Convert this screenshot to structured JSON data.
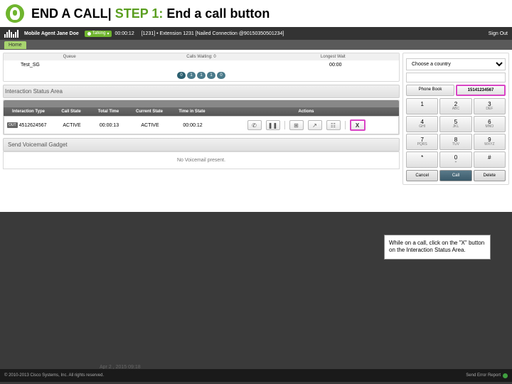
{
  "slide": {
    "title_pre": "END A CALL| ",
    "title_step": "STEP 1: ",
    "title_post": "End a call button"
  },
  "topbar": {
    "agent": "Mobile Agent Jane Doe",
    "state": "Talking",
    "timer": "00:00:12",
    "ext": "[1231] • Extension 1231 [Nailed Connection @90150350501234]",
    "signout": "Sign Out"
  },
  "tabs": {
    "home": "Home"
  },
  "queue": {
    "h1": "Queue",
    "h2": "Calls Waiting: 0",
    "h3": "Longest Wait",
    "name": "Test_SG",
    "waiting": "",
    "longest": "00:00",
    "pages": [
      "0",
      "1",
      "1",
      "1",
      "0"
    ]
  },
  "interaction": {
    "label": "Interaction Status Area",
    "cols": {
      "type": "Interaction Type",
      "state": "Call State",
      "total": "Total Time",
      "cur": "Current State",
      "tis": "Time in State",
      "act": "Actions"
    },
    "row": {
      "dir": "OUT",
      "num": "4512624567",
      "state": "ACTIVE",
      "total": "00:00:13",
      "cur": "ACTIVE",
      "tis": "00:00:12",
      "end": "X"
    }
  },
  "voicemail": {
    "label": "Send Voicemail Gadget",
    "empty": "No Voicemail present."
  },
  "dialer": {
    "country": "Choose a country",
    "phonebook": "Phone Book",
    "this_num": "15141234567",
    "keys": [
      {
        "n": "1",
        "t": ""
      },
      {
        "n": "2",
        "t": "ABC"
      },
      {
        "n": "3",
        "t": "DEF"
      },
      {
        "n": "4",
        "t": "GHI"
      },
      {
        "n": "5",
        "t": "JKL"
      },
      {
        "n": "6",
        "t": "MNO"
      },
      {
        "n": "7",
        "t": "PQRS"
      },
      {
        "n": "8",
        "t": "TUV"
      },
      {
        "n": "9",
        "t": "WXYZ"
      },
      {
        "n": "*",
        "t": ""
      },
      {
        "n": "0",
        "t": "+"
      },
      {
        "n": "#",
        "t": ""
      }
    ],
    "cancel": "Cancel",
    "call": "Call",
    "delete": "Delete"
  },
  "callout": "While on a call, click on the \"X\" button on the Interaction Status Area.",
  "footer": {
    "copy": "© 2010-2013 Cisco Systems, Inc. All rights reserved.",
    "ghost": "Apr 2 , 2015 09:18",
    "report": "Send Error Report"
  }
}
